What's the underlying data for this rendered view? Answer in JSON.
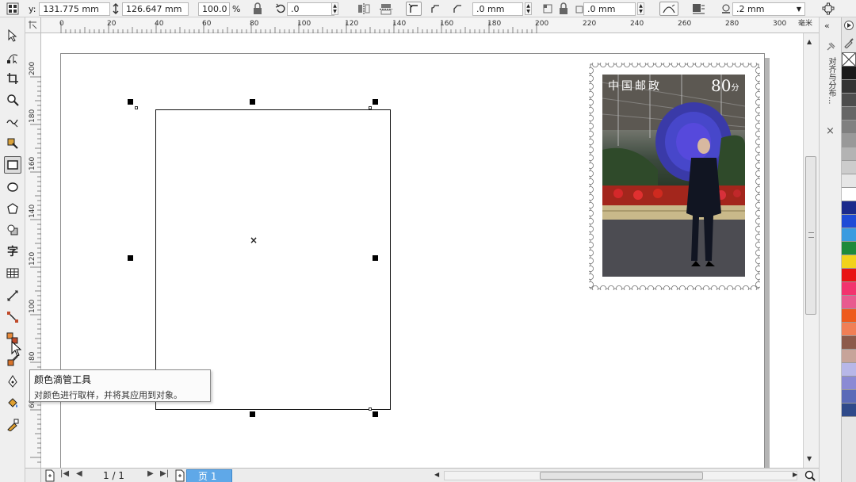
{
  "property_bar": {
    "y_label": "y:",
    "y_value": "131.775 mm",
    "height_value": "126.647 mm",
    "scale_value": "100.0",
    "scale_unit": "%",
    "rotation_value": ".0",
    "corner_x_value": ".0 mm",
    "corner_y_value": ".0 mm",
    "outline_width_value": ".2 mm"
  },
  "ruler": {
    "unit": "毫米",
    "h_ticks": [
      "0",
      "20",
      "40",
      "60",
      "80",
      "100",
      "120",
      "140",
      "160",
      "180",
      "200",
      "220",
      "240",
      "260",
      "280",
      "300"
    ],
    "v_ticks": [
      "200",
      "180",
      "160",
      "140",
      "120",
      "100",
      "80",
      "60"
    ]
  },
  "tooltip": {
    "title": "颜色滴管工具",
    "description": "对颜色进行取样，并将其应用到对象。"
  },
  "stamp": {
    "text": "中国邮政",
    "value": "80",
    "unit": "分"
  },
  "toolbox": {
    "text_tool_glyph": "字"
  },
  "status_bar": {
    "page_counter": "1 / 1",
    "page_tab": "页 1"
  },
  "docker": {
    "title": "对齐与分布..."
  },
  "palette": {
    "colors": [
      "#1a1a1a",
      "#333333",
      "#4d4d4d",
      "#666666",
      "#808080",
      "#999999",
      "#b3b3b3",
      "#cccccc",
      "#e6e6e6",
      "#ffffff",
      "#1b2a8c",
      "#1f4bd6",
      "#3a9be0",
      "#1e8a3b",
      "#f2d21c",
      "#e81313",
      "#f2336e",
      "#e85a8f",
      "#ee5a1c",
      "#f07f56",
      "#8c5a4a",
      "#c7a49a",
      "#b7b7e8",
      "#8a8ad4",
      "#5a6ab8",
      "#2f4a8a"
    ]
  }
}
